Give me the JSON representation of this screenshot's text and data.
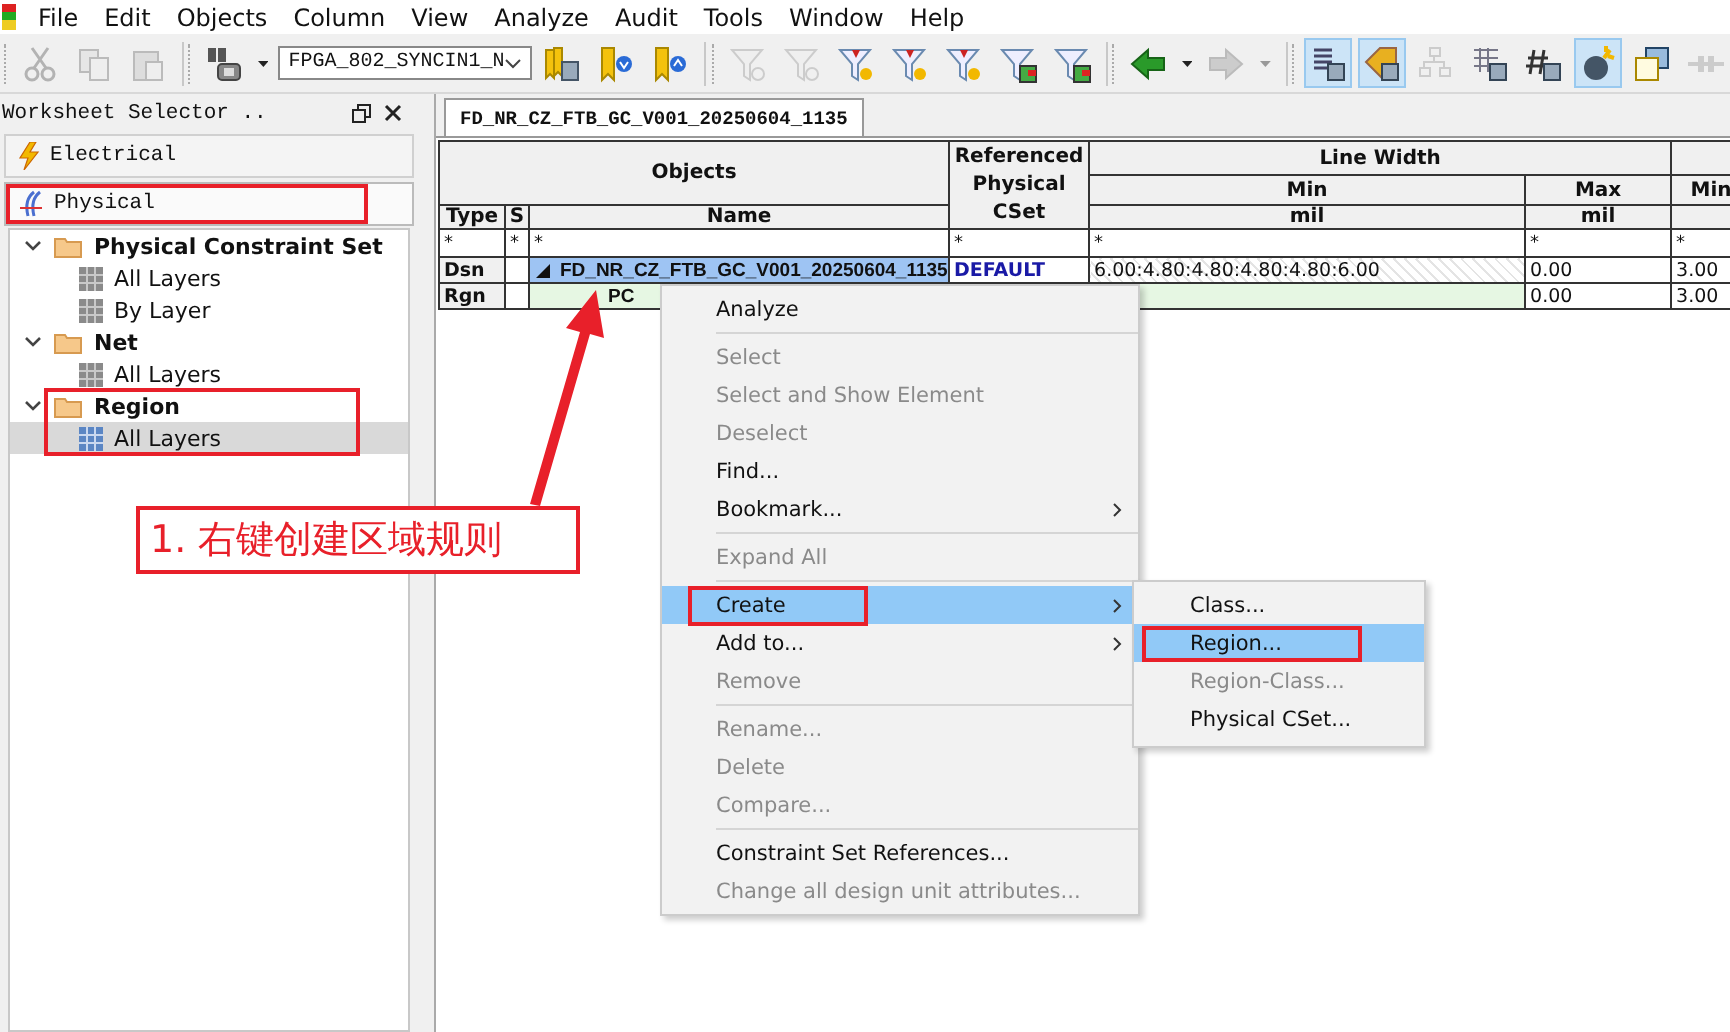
{
  "menubar": [
    "File",
    "Edit",
    "Objects",
    "Column",
    "View",
    "Analyze",
    "Audit",
    "Tools",
    "Window",
    "Help"
  ],
  "toolbar": [
    {
      "kind": "cut",
      "disabled": true,
      "pressed": false
    },
    {
      "kind": "copy",
      "disabled": true,
      "pressed": false
    },
    {
      "kind": "paste",
      "disabled": true,
      "pressed": false
    },
    {
      "kind": "separator"
    },
    {
      "kind": "lookup",
      "disabled": false,
      "pressed": false
    },
    {
      "kind": "caret",
      "disabled": false
    },
    {
      "kind": "combo",
      "value": "FPGA_802_SYNCIN1_N"
    },
    {
      "kind": "bookmarks",
      "disabled": false,
      "pressed": false
    },
    {
      "kind": "bookmark_down",
      "disabled": false,
      "pressed": false
    },
    {
      "kind": "bookmark_up",
      "disabled": false,
      "pressed": false
    },
    {
      "kind": "separator"
    },
    {
      "kind": "filter",
      "disabled": true,
      "pressed": false
    },
    {
      "kind": "filter",
      "disabled": true,
      "pressed": false
    },
    {
      "kind": "filter_red",
      "disabled": false,
      "pressed": false
    },
    {
      "kind": "filter_red",
      "disabled": false,
      "pressed": false
    },
    {
      "kind": "filter_red",
      "disabled": false,
      "pressed": false
    },
    {
      "kind": "filter_grid",
      "disabled": false,
      "pressed": false
    },
    {
      "kind": "filter_grid",
      "disabled": false,
      "pressed": false
    },
    {
      "kind": "separator"
    },
    {
      "kind": "back",
      "disabled": false,
      "pressed": false
    },
    {
      "kind": "caret",
      "disabled": false
    },
    {
      "kind": "forward",
      "disabled": true,
      "pressed": false
    },
    {
      "kind": "caret",
      "disabled": true
    },
    {
      "kind": "separator"
    },
    {
      "kind": "sheet",
      "disabled": false,
      "pressed": true
    },
    {
      "kind": "tag",
      "disabled": false,
      "pressed": true
    },
    {
      "kind": "hierarchy",
      "disabled": true,
      "pressed": false
    },
    {
      "kind": "grid",
      "disabled": false,
      "pressed": false
    },
    {
      "kind": "hash",
      "disabled": false,
      "pressed": false
    },
    {
      "kind": "bomb",
      "disabled": false,
      "pressed": true
    },
    {
      "kind": "windows",
      "disabled": false,
      "pressed": false
    },
    {
      "kind": "connector",
      "disabled": true,
      "pressed": false
    }
  ],
  "worksheet_selector": {
    "title": "Worksheet Selector ..",
    "tabs": [
      {
        "label": "Electrical",
        "kind": "electrical",
        "selected": false,
        "outlined": false
      },
      {
        "label": "Physical",
        "kind": "physical",
        "selected": true,
        "outlined": true
      }
    ],
    "tree": [
      {
        "label": "Physical Constraint Set",
        "expanded": true,
        "outlined": false,
        "children": [
          {
            "label": "All Layers",
            "selected": false
          },
          {
            "label": "By Layer",
            "selected": false
          }
        ]
      },
      {
        "label": "Net",
        "expanded": true,
        "outlined": false,
        "children": [
          {
            "label": "All Layers",
            "selected": false
          }
        ]
      },
      {
        "label": "Region",
        "expanded": true,
        "outlined": true,
        "children": [
          {
            "label": "All Layers",
            "selected": true
          }
        ]
      }
    ]
  },
  "worksheet_tab": {
    "label": "FD_NR_CZ_FTB_GC_V001_20250604_1135"
  },
  "table": {
    "headers": {
      "objects": "Objects",
      "type": "Type",
      "s": "S",
      "name": "Name",
      "referenced": "Referenced Physical CSet",
      "line_width": "Line Width",
      "min": "Min",
      "max": "Max",
      "unit_min": "mil",
      "unit_max": "mil",
      "column_8": "Min"
    },
    "filters": [
      "*",
      "*",
      "*",
      "*",
      "*",
      "*",
      "*"
    ],
    "rows": [
      {
        "kind": "design",
        "type": "Dsn",
        "name": "FD_NR_CZ_FTB_GC_V001_20250604_1135",
        "referenced": "DEFAULT",
        "min": "6.00:4.80:4.80:4.80:4.80:6.00",
        "max": "0.00",
        "column_8": "3.00",
        "selected": true
      },
      {
        "kind": "region",
        "type": "Rgn",
        "name": "PC",
        "max": "0.00",
        "column_8": "3.00",
        "selected": false
      }
    ]
  },
  "context_menu": {
    "items": [
      {
        "kind": "item",
        "label": "Analyze",
        "disabled": false,
        "submenu": false,
        "selected": false,
        "outlined": false
      },
      {
        "kind": "separator"
      },
      {
        "kind": "item",
        "label": "Select",
        "disabled": true,
        "submenu": false,
        "selected": false,
        "outlined": false
      },
      {
        "kind": "item",
        "label": "Select and Show Element",
        "disabled": true,
        "submenu": false,
        "selected": false,
        "outlined": false
      },
      {
        "kind": "item",
        "label": "Deselect",
        "disabled": true,
        "submenu": false,
        "selected": false,
        "outlined": false
      },
      {
        "kind": "item",
        "label": "Find...",
        "disabled": false,
        "submenu": false,
        "selected": false,
        "outlined": false
      },
      {
        "kind": "item",
        "label": "Bookmark...",
        "disabled": false,
        "submenu": true,
        "selected": false,
        "outlined": false
      },
      {
        "kind": "separator"
      },
      {
        "kind": "item",
        "label": "Expand All",
        "disabled": true,
        "submenu": false,
        "selected": false,
        "outlined": false
      },
      {
        "kind": "separator"
      },
      {
        "kind": "item",
        "label": "Create",
        "disabled": false,
        "submenu": true,
        "selected": true,
        "outlined": true
      },
      {
        "kind": "item",
        "label": "Add to...",
        "disabled": false,
        "submenu": true,
        "selected": false,
        "outlined": false
      },
      {
        "kind": "item",
        "label": "Remove",
        "disabled": true,
        "submenu": false,
        "selected": false,
        "outlined": false
      },
      {
        "kind": "separator"
      },
      {
        "kind": "item",
        "label": "Rename...",
        "disabled": true,
        "submenu": false,
        "selected": false,
        "outlined": false
      },
      {
        "kind": "item",
        "label": "Delete",
        "disabled": true,
        "submenu": false,
        "selected": false,
        "outlined": false
      },
      {
        "kind": "item",
        "label": "Compare...",
        "disabled": true,
        "submenu": false,
        "selected": false,
        "outlined": false
      },
      {
        "kind": "separator"
      },
      {
        "kind": "item",
        "label": "Constraint Set References...",
        "disabled": false,
        "submenu": false,
        "selected": false,
        "outlined": false
      },
      {
        "kind": "item",
        "label": "Change all design unit attributes...",
        "disabled": true,
        "submenu": false,
        "selected": false,
        "outlined": false
      }
    ]
  },
  "submenu": {
    "items": [
      {
        "label": "Class...",
        "disabled": false,
        "selected": false,
        "outlined": false
      },
      {
        "label": "Region...",
        "disabled": false,
        "selected": true,
        "outlined": true
      },
      {
        "label": "Region-Class...",
        "disabled": true,
        "selected": false,
        "outlined": false
      },
      {
        "label": "Physical CSet...",
        "disabled": false,
        "selected": false,
        "outlined": false
      }
    ]
  },
  "annotation": {
    "text": "1. 右键创建区域规则"
  }
}
